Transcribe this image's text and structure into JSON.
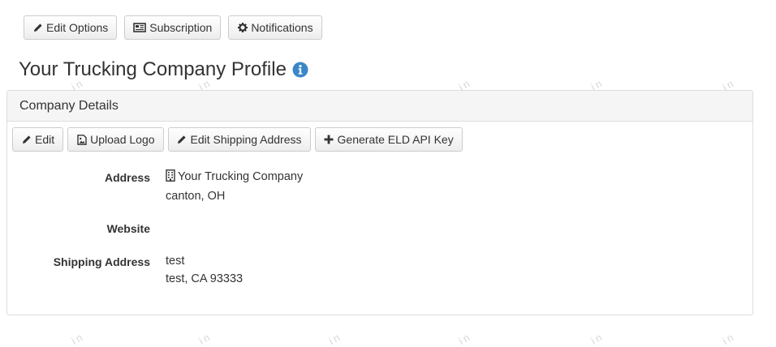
{
  "toolbar": {
    "edit_options": "Edit Options",
    "subscription": "Subscription",
    "notifications": "Notifications"
  },
  "page": {
    "title": "Your Trucking Company Profile"
  },
  "panel": {
    "heading": "Company Details",
    "buttons": {
      "edit": "Edit",
      "upload_logo": "Upload Logo",
      "edit_shipping_address": "Edit Shipping Address",
      "generate_eld_api_key": "Generate ELD API Key"
    },
    "details": {
      "address_label": "Address",
      "address_line1": "Your Trucking Company",
      "address_line2": "canton, OH",
      "website_label": "Website",
      "website_value": "",
      "shipping_label": "Shipping Address",
      "shipping_line1": "test",
      "shipping_line2": "test, CA 93333"
    }
  },
  "watermark": "in",
  "colors": {
    "info_icon": "#3a87c8",
    "panel_heading_bg": "#f5f5f5",
    "border": "#cccccc"
  },
  "icons": {
    "edit_options": "pencil-icon",
    "subscription": "newspaper-icon",
    "notifications": "gear-icon",
    "title": "info-circle-icon",
    "edit": "pencil-icon",
    "upload_logo": "picture-file-icon",
    "edit_shipping": "pencil-icon",
    "generate_key": "plus-icon",
    "address": "building-icon"
  }
}
